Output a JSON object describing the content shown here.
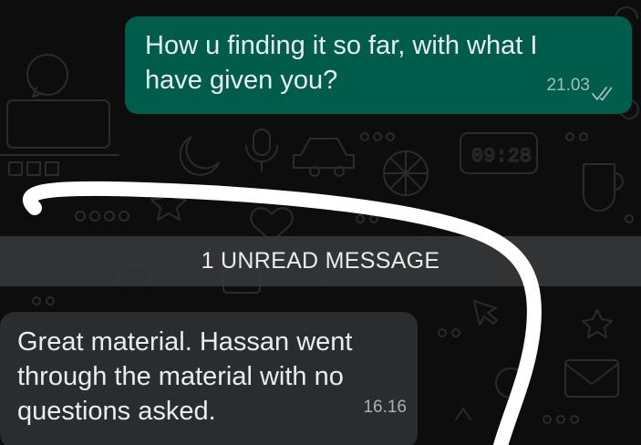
{
  "colors": {
    "background": "#0d0d0d",
    "outgoing_bubble": "#005c4b",
    "incoming_bubble": "#2a2d2f",
    "unread_bar": "#343638",
    "text": "#e9edef",
    "ticks": "#aebac1",
    "annotation": "#ffffff"
  },
  "messages": [
    {
      "direction": "outgoing",
      "lines": [
        "How u finding it so far, with what I",
        "have given you?"
      ],
      "time": "21.03",
      "status_icon": "double-check-icon"
    },
    {
      "direction": "incoming",
      "lines": [
        "Great material. Hassan went",
        "through the material with no",
        "questions asked."
      ],
      "time": "16.16"
    }
  ],
  "unread_divider": {
    "label": "1 UNREAD MESSAGE"
  },
  "wallpaper": {
    "clock_label": "09:28"
  }
}
